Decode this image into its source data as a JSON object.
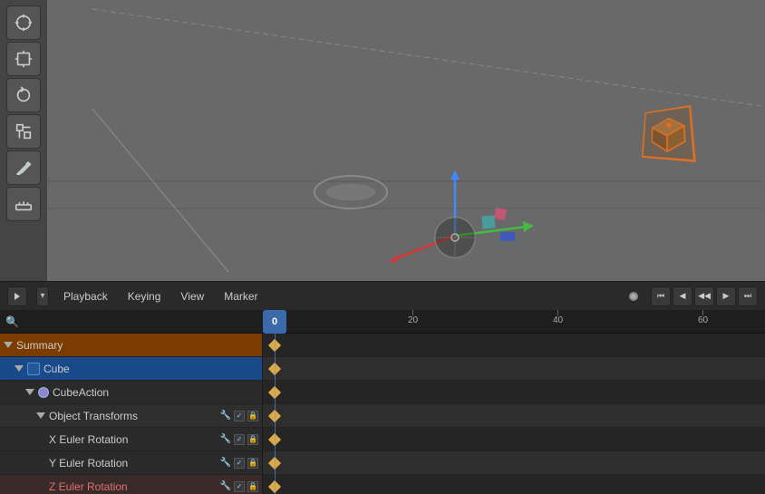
{
  "viewport": {
    "bg_color": "#696969"
  },
  "toolbar": {
    "tools": [
      {
        "name": "cursor-tool",
        "label": "⊕"
      },
      {
        "name": "move-tool",
        "label": "↔"
      },
      {
        "name": "rotate-tool",
        "label": "↻"
      },
      {
        "name": "scale-tool",
        "label": "⤡"
      },
      {
        "name": "annotate-tool",
        "label": "✏"
      },
      {
        "name": "measure-tool",
        "label": "📐"
      }
    ]
  },
  "timeline": {
    "playback_label": "Playback",
    "keying_label": "Keying",
    "view_label": "View",
    "marker_label": "Marker",
    "current_frame": "0",
    "frame_marks": [
      {
        "value": "0",
        "offset": 13
      },
      {
        "value": "20",
        "offset": 173
      },
      {
        "value": "40",
        "offset": 333
      },
      {
        "value": "60",
        "offset": 493
      }
    ]
  },
  "channels": [
    {
      "id": "summary",
      "label": "Summary",
      "indent": 1,
      "class": "ch-summary",
      "arrow": "down",
      "has_icons": false
    },
    {
      "id": "cube",
      "label": "Cube",
      "indent": 2,
      "class": "ch-cube",
      "arrow": "down",
      "has_icons": false,
      "icon": "cube"
    },
    {
      "id": "cube-action",
      "label": "CubeAction",
      "indent": 3,
      "class": "ch-action",
      "arrow": "down",
      "has_icons": false,
      "icon": "action"
    },
    {
      "id": "obj-transforms",
      "label": "Object Transforms",
      "indent": 4,
      "class": "ch-transforms",
      "arrow": "down",
      "has_icons": true
    },
    {
      "id": "euler-x",
      "label": "X Euler Rotation",
      "indent": 4,
      "class": "ch-euler-x",
      "arrow": "none",
      "has_icons": true
    },
    {
      "id": "euler-y",
      "label": "Y Euler Rotation",
      "indent": 4,
      "class": "ch-euler-y",
      "arrow": "none",
      "has_icons": true
    },
    {
      "id": "euler-z",
      "label": "Z Euler Rotation",
      "indent": 4,
      "class": "ch-euler-z",
      "arrow": "none",
      "has_icons": true
    }
  ],
  "keyframes": {
    "rows": [
      {
        "id": "summary",
        "diamonds": [
          13
        ]
      },
      {
        "id": "cube",
        "diamonds": [
          13
        ]
      },
      {
        "id": "cube-action",
        "diamonds": [
          13
        ]
      },
      {
        "id": "obj-transforms",
        "diamonds": [
          13,
          593
        ]
      },
      {
        "id": "euler-x",
        "diamonds": [
          13,
          593
        ]
      },
      {
        "id": "euler-y",
        "diamonds": [
          13,
          593
        ]
      },
      {
        "id": "euler-z",
        "diamonds": [
          13,
          593
        ]
      }
    ]
  },
  "search": {
    "placeholder": "🔍"
  }
}
